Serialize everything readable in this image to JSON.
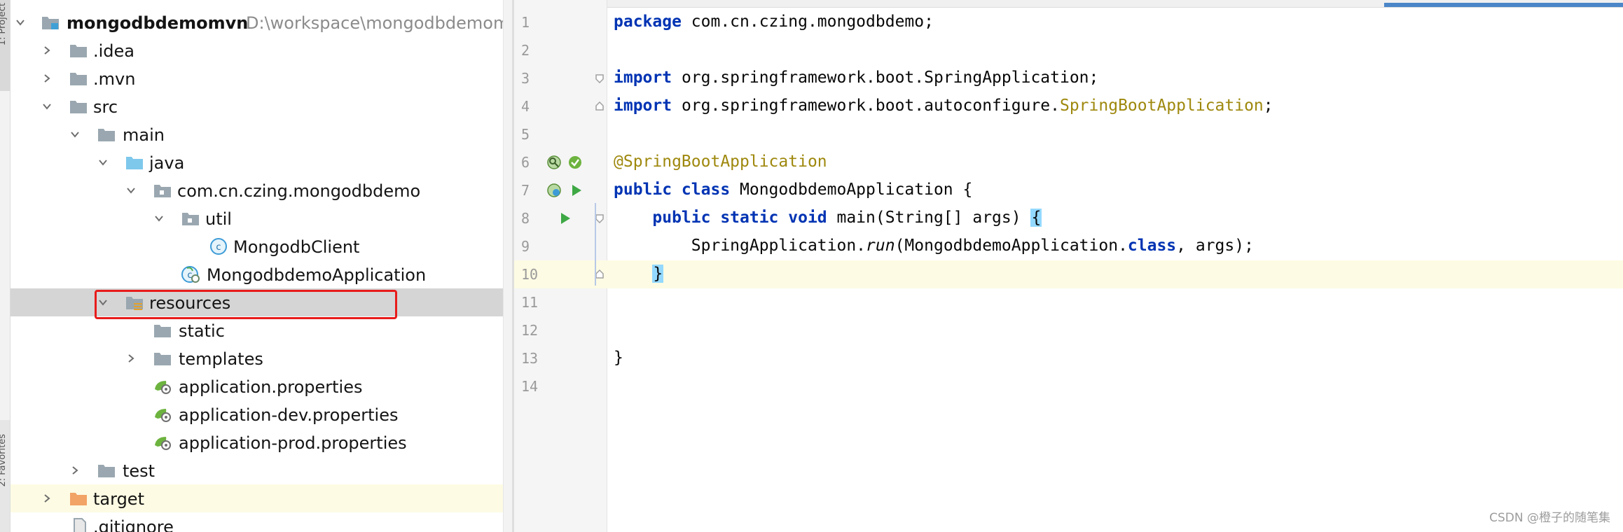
{
  "sidebar": {
    "top_tab_label": "1: Project",
    "bottom_tab_label": "2: Favorites"
  },
  "project_tree": {
    "items": [
      {
        "label": "mongodbdemomvn",
        "path": "D:\\workspace\\mongodbdemomvn",
        "expanded": true,
        "icon": "module-folder-icon"
      },
      {
        "label": ".idea",
        "expanded": false,
        "icon": "folder-icon"
      },
      {
        "label": ".mvn",
        "expanded": false,
        "icon": "folder-icon"
      },
      {
        "label": "src",
        "expanded": true,
        "icon": "folder-icon"
      },
      {
        "label": "main",
        "expanded": true,
        "icon": "folder-icon"
      },
      {
        "label": "java",
        "expanded": true,
        "icon": "source-folder-icon"
      },
      {
        "label": "com.cn.czing.mongodbdemo",
        "expanded": true,
        "icon": "package-icon"
      },
      {
        "label": "util",
        "expanded": true,
        "icon": "package-icon"
      },
      {
        "label": "MongodbClient",
        "icon": "class-icon"
      },
      {
        "label": "MongodbdemoApplication",
        "icon": "spring-class-icon"
      },
      {
        "label": "resources",
        "expanded": true,
        "icon": "resources-folder-icon",
        "selected": true
      },
      {
        "label": "static",
        "icon": "folder-icon"
      },
      {
        "label": "templates",
        "expanded": false,
        "icon": "folder-icon"
      },
      {
        "label": "application.properties",
        "icon": "spring-properties-icon"
      },
      {
        "label": "application-dev.properties",
        "icon": "spring-properties-icon"
      },
      {
        "label": "application-prod.properties",
        "icon": "spring-properties-icon"
      },
      {
        "label": "test",
        "expanded": false,
        "icon": "folder-icon"
      },
      {
        "label": "target",
        "expanded": false,
        "icon": "excluded-folder-icon"
      },
      {
        "label": ".gitignore",
        "icon": "file-icon"
      }
    ]
  },
  "editor": {
    "lines": [
      {
        "num": "1"
      },
      {
        "num": "2"
      },
      {
        "num": "3"
      },
      {
        "num": "4"
      },
      {
        "num": "5"
      },
      {
        "num": "6"
      },
      {
        "num": "7"
      },
      {
        "num": "8"
      },
      {
        "num": "9"
      },
      {
        "num": "10"
      },
      {
        "num": "11"
      },
      {
        "num": "12"
      },
      {
        "num": "13"
      },
      {
        "num": "14"
      }
    ],
    "code": {
      "l1_kw": "package",
      "l1_rest": " com.cn.czing.mongodbdemo;",
      "l3_kw": "import",
      "l3_rest": " org.springframework.boot.SpringApplication;",
      "l4_kw": "import",
      "l4_rest": " org.springframework.boot.autoconfigure.",
      "l4_ann": "SpringBootApplication",
      "l4_end": ";",
      "l6_ann": "@SpringBootApplication",
      "l7_kw": "public class",
      "l7_rest": " MongodbdemoApplication {",
      "l8_indent": "    ",
      "l8_kw": "public static void",
      "l8_rest": " main(String[] args) ",
      "l8_brace": "{",
      "l9_indent": "        ",
      "l9_a": "SpringApplication.",
      "l9_run": "run",
      "l9_b": "(MongodbdemoApplication.",
      "l9_kw": "class",
      "l9_c": ", args);",
      "l10_indent": "    ",
      "l10_brace": "}",
      "l13": "}"
    }
  },
  "watermark": "CSDN @橙子的随笔集",
  "colors": {
    "keyword": "#0033b3",
    "annotation": "#9e880d",
    "selection_highlight": "#e81b1b",
    "current_line": "#fdfbe3"
  }
}
